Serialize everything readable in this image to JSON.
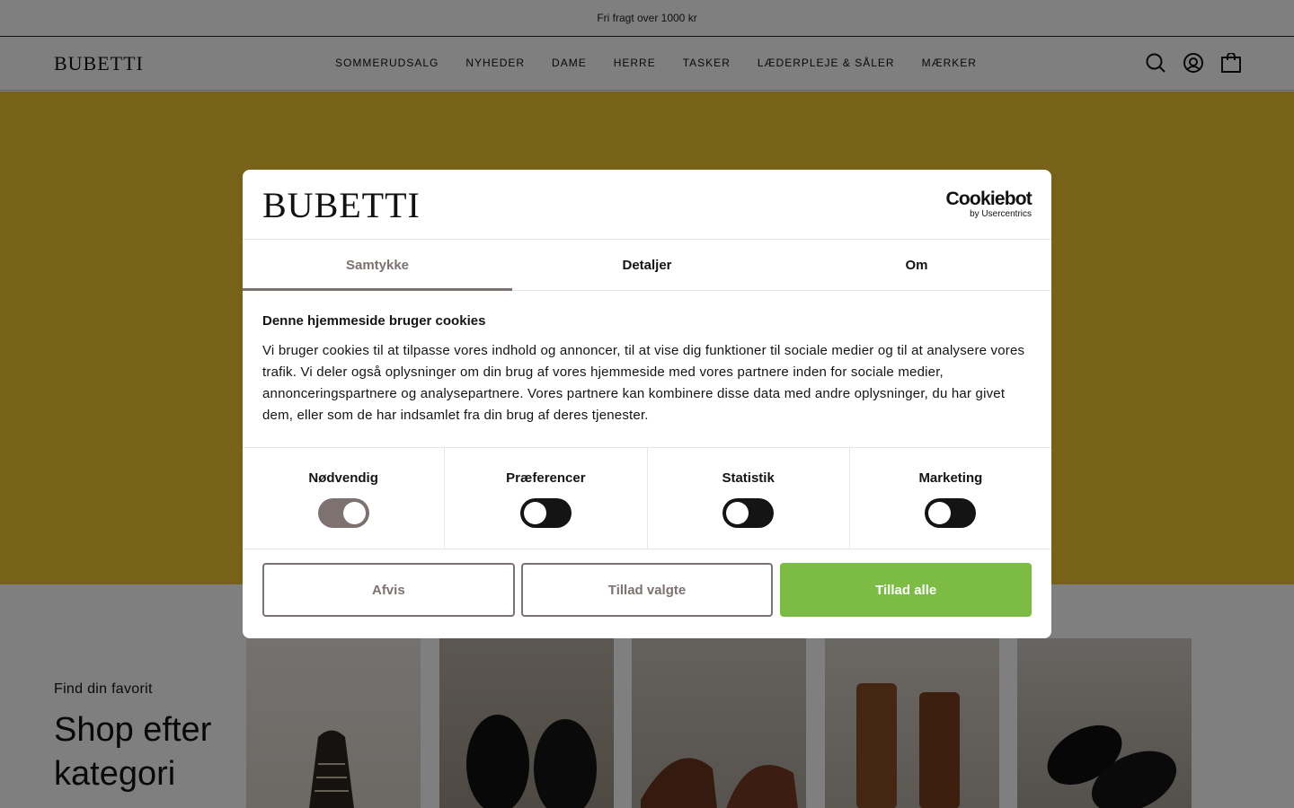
{
  "announcement": {
    "text": "Fri fragt over 1000 kr"
  },
  "header": {
    "logo": "BUBETTI",
    "nav": [
      "SOMMERUDSALG",
      "NYHEDER",
      "DAME",
      "HERRE",
      "TASKER",
      "LÆDERPLEJE & SÅLER",
      "MÆRKER"
    ],
    "icons": [
      "search-icon",
      "account-icon",
      "bag-icon"
    ]
  },
  "category_section": {
    "eyebrow": "Find din favorit",
    "title": "Shop efter kategori"
  },
  "cookie_dialog": {
    "logo": "BUBETTI",
    "provider": {
      "name": "Cookiebot",
      "sub": "by Usercentrics"
    },
    "tabs": [
      {
        "label": "Samtykke",
        "active": true
      },
      {
        "label": "Detaljer",
        "active": false
      },
      {
        "label": "Om",
        "active": false
      }
    ],
    "heading": "Denne hjemmeside bruger cookies",
    "body": "Vi bruger cookies til at tilpasse vores indhold og annoncer, til at vise dig funktioner til sociale medier og til at analysere vores trafik. Vi deler også oplysninger om din brug af vores hjemmeside med vores partnere inden for sociale medier, annonceringspartnere og analysepartnere. Vores partnere kan kombinere disse data med andre oplysninger, du har givet dem, eller som de har indsamlet fra din brug af deres tjenester.",
    "toggles": [
      {
        "label": "Nødvendig",
        "on": true
      },
      {
        "label": "Præferencer",
        "on": false
      },
      {
        "label": "Statistik",
        "on": false
      },
      {
        "label": "Marketing",
        "on": false
      }
    ],
    "buttons": {
      "reject": "Afvis",
      "allow_selected": "Tillad valgte",
      "allow_all": "Tillad alle"
    },
    "colors": {
      "accent": "#7d7270",
      "primary": "#7cbc45",
      "hero": "#f1c230"
    }
  }
}
